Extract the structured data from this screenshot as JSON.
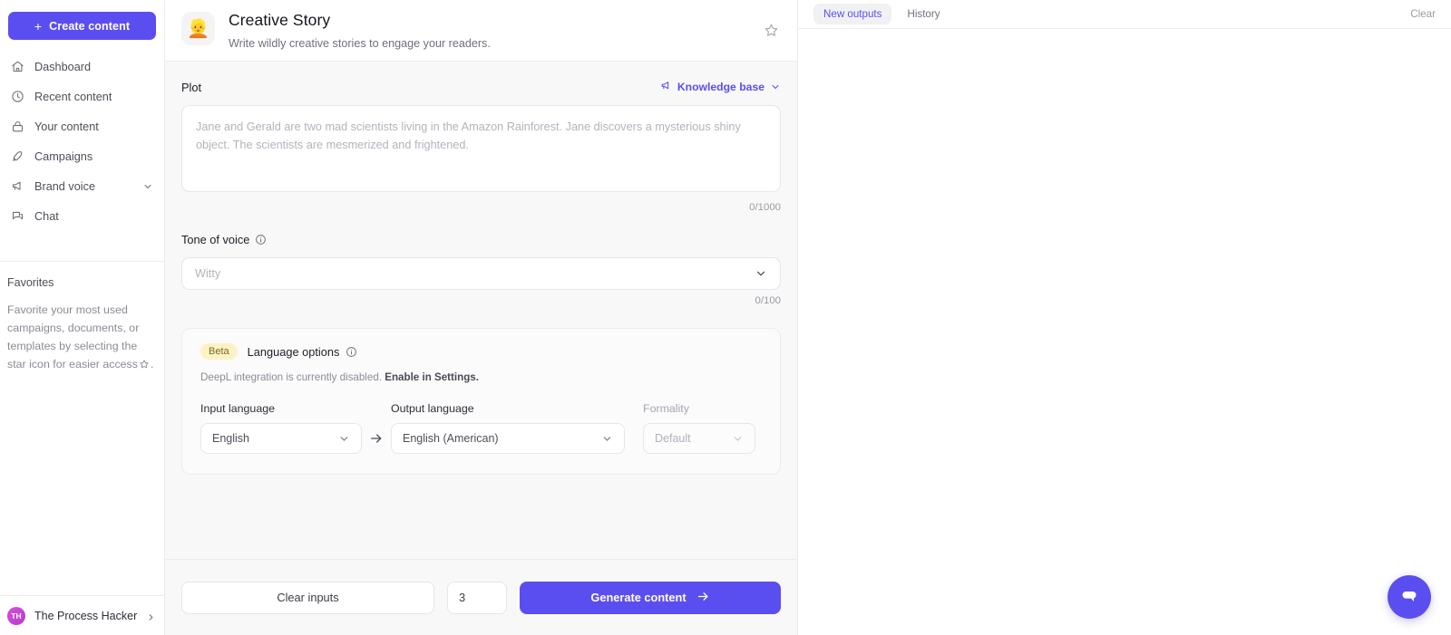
{
  "sidebar": {
    "create_button": {
      "label": "Create content",
      "icon": "plus-icon"
    },
    "items": [
      {
        "label": "Dashboard",
        "icon": "home-icon"
      },
      {
        "label": "Recent content",
        "icon": "clock-icon"
      },
      {
        "label": "Your content",
        "icon": "lock-icon"
      },
      {
        "label": "Campaigns",
        "icon": "rocket-icon"
      },
      {
        "label": "Brand voice",
        "icon": "megaphone-icon",
        "chevron": "chevron-down-icon"
      },
      {
        "label": "Chat",
        "icon": "chat-icon"
      }
    ],
    "favorites": {
      "title": "Favorites",
      "description_before": "Favorite your most used campaigns, documents, or templates by selecting the star",
      "description_after": "icon for easier access",
      "trailing": "."
    },
    "user": {
      "initials": "TH",
      "name": "The Process Hacker",
      "chevron": "chevron-right-icon"
    }
  },
  "template_header": {
    "emoji": "👱",
    "title": "Creative Story",
    "subtitle": "Write wildly creative stories to engage your readers.",
    "favorite_icon": "star-outline-icon"
  },
  "plot_field": {
    "label": "Plot",
    "knowledge_base_label": "Knowledge base",
    "knowledge_base_icon": "megaphone-icon",
    "value": "",
    "placeholder": "Jane and Gerald are two mad scientists living in the Amazon Rainforest. Jane discovers a mysterious shiny object. The scientists are mesmerized and frightened.",
    "counter": "0/1000"
  },
  "tone_field": {
    "label": "Tone of voice",
    "info_icon": "info-icon",
    "value": "",
    "placeholder": "Witty",
    "counter": "0/100"
  },
  "language_options": {
    "badge": "Beta",
    "title": "Language options",
    "info_icon": "info-icon",
    "note_text": "DeepL integration is currently disabled.",
    "note_link": "Enable in Settings.",
    "input": {
      "label": "Input language",
      "value": "English"
    },
    "arrow_icon": "arrow-right-icon",
    "output": {
      "label": "Output language",
      "value": "English (American)"
    },
    "formality": {
      "label": "Formality",
      "value": "Default",
      "disabled": true
    }
  },
  "bottom_bar": {
    "clear_label": "Clear inputs",
    "quantity": "3",
    "generate_label": "Generate content",
    "generate_icon": "arrow-right-icon"
  },
  "right_panel": {
    "tabs": [
      {
        "label": "New outputs",
        "active": true
      },
      {
        "label": "History",
        "active": false
      }
    ],
    "clear_label": "Clear",
    "chat_fab_icon": "chat-bubble-icon"
  },
  "colors": {
    "accent": "#5b4ef0",
    "badge_bg": "#fcf2c5",
    "badge_text": "#7d6a1e",
    "panel_bg": "#f8f8f9",
    "avatar_gradient_start": "#d94fd6"
  }
}
